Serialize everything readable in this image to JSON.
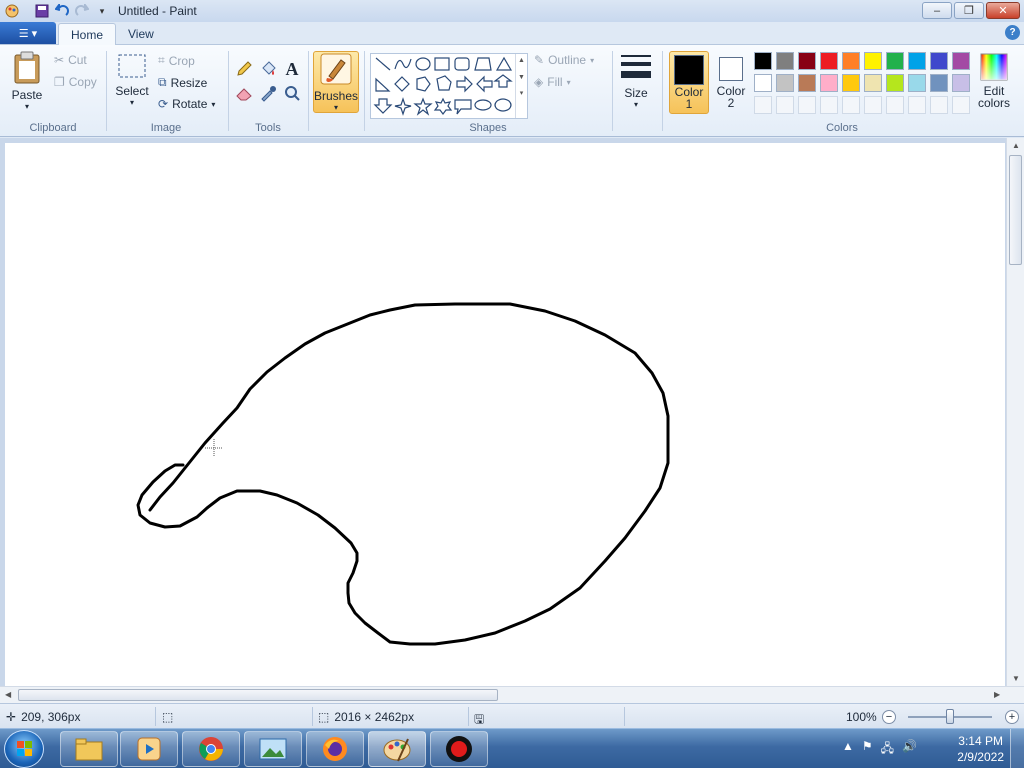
{
  "window": {
    "title": "Untitled - Paint",
    "minimize_glyph": "–",
    "maximize_glyph": "❐",
    "close_glyph": "✕"
  },
  "tabs": {
    "home": "Home",
    "view": "View",
    "help_glyph": "?"
  },
  "clipboard": {
    "paste": "Paste",
    "cut": "Cut",
    "copy": "Copy",
    "group_label": "Clipboard"
  },
  "image": {
    "select": "Select",
    "crop": "Crop",
    "resize": "Resize",
    "rotate": "Rotate",
    "group_label": "Image"
  },
  "tools": {
    "group_label": "Tools",
    "text_glyph": "A"
  },
  "brushes": {
    "label": "Brushes"
  },
  "shapes": {
    "outline": "Outline",
    "fill": "Fill",
    "group_label": "Shapes"
  },
  "size": {
    "label": "Size"
  },
  "colors": {
    "color1_line1": "Color",
    "color1_line2": "1",
    "color2_line1": "Color",
    "color2_line2": "2",
    "edit_line1": "Edit",
    "edit_line2": "colors",
    "group_label": "Colors",
    "color1": "#000000",
    "color2": "#ffffff",
    "palette_row1": [
      "#000000",
      "#7f7f7f",
      "#880015",
      "#ed1c24",
      "#ff7f27",
      "#fff200",
      "#22b14c",
      "#00a2e8",
      "#3f48cc",
      "#a349a4"
    ],
    "palette_row2": [
      "#ffffff",
      "#c3c3c3",
      "#b97a57",
      "#ffaec9",
      "#ffc90e",
      "#efe4b0",
      "#b5e61d",
      "#99d9ea",
      "#7092be",
      "#c8bfe7"
    ]
  },
  "status": {
    "cursor_pos": "209, 306px",
    "canvas_size": "2016 × 2462px",
    "zoom": "100%"
  },
  "taskbar": {
    "time": "3:14 PM",
    "date": "2/9/2022"
  }
}
